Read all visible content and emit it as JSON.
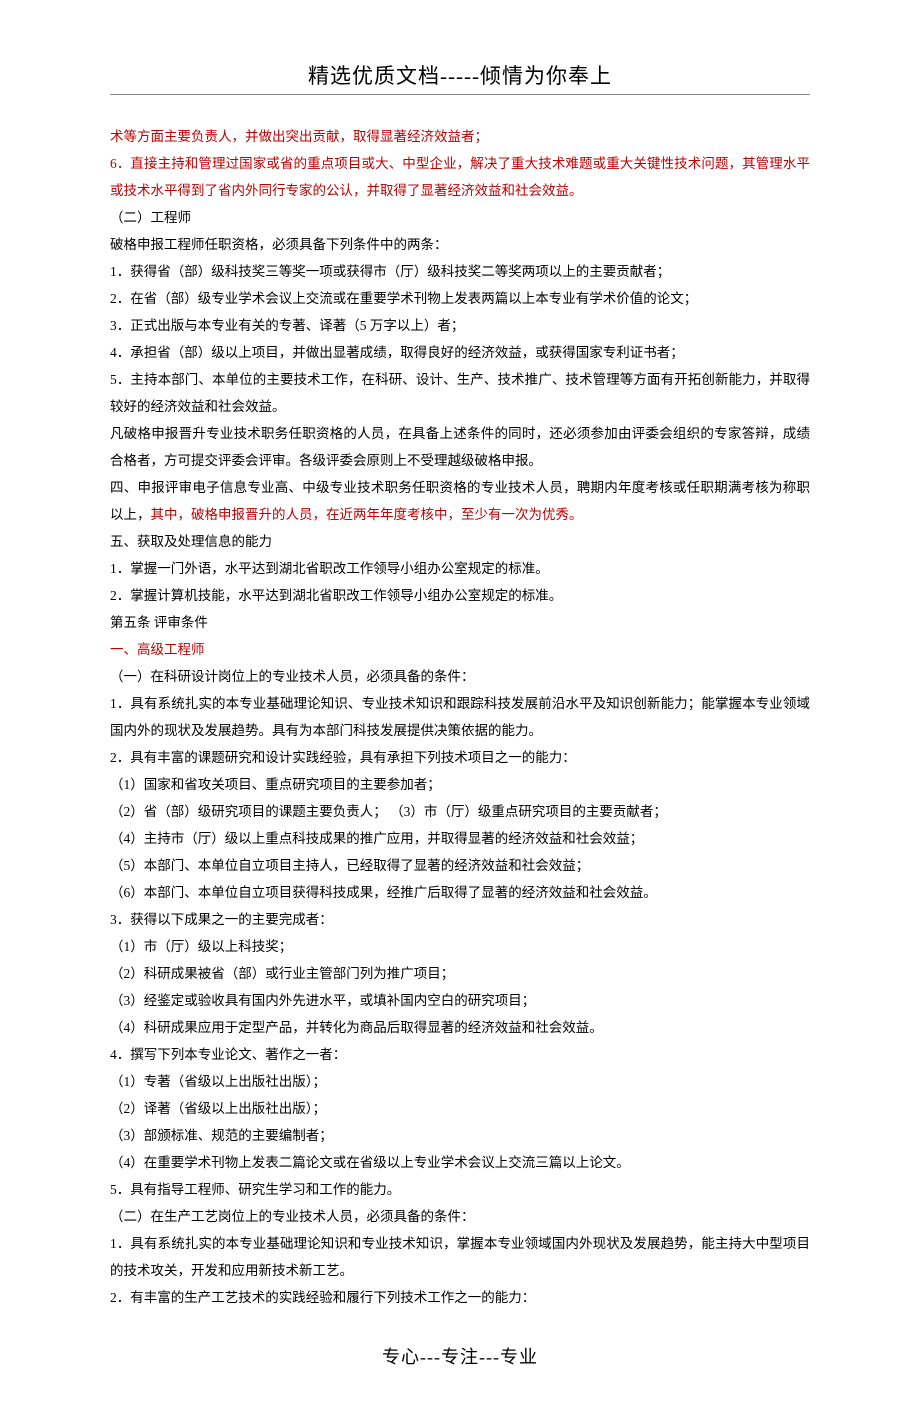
{
  "header": "精选优质文档-----倾情为你奉上",
  "footer": "专心---专注---专业",
  "lines": [
    {
      "text": "术等方面主要负责人，并做出突出贡献，取得显著经济效益者；",
      "red": true
    },
    {
      "text": "6．直接主持和管理过国家或省的重点项目或大、中型企业，解决了重大技术难题或重大关键性技术问题，其管理水平或技术水平得到了省内外同行专家的公认，并取得了显著经济效益和社会效益。",
      "red": true
    },
    {
      "text": "（二）工程师",
      "red": false
    },
    {
      "text": "破格申报工程师任职资格，必须具备下列条件中的两条：",
      "red": false
    },
    {
      "text": "1．获得省（部）级科技奖三等奖一项或获得市（厅）级科技奖二等奖两项以上的主要贡献者；",
      "red": false
    },
    {
      "text": "2．在省（部）级专业学术会议上交流或在重要学术刊物上发表两篇以上本专业有学术价值的论文；",
      "red": false
    },
    {
      "text": "3．正式出版与本专业有关的专著、译著（5 万字以上）者；",
      "red": false
    },
    {
      "text": "4．承担省（部）级以上项目，并做出显著成绩，取得良好的经济效益，或获得国家专利证书者；",
      "red": false
    },
    {
      "text": "5．主持本部门、本单位的主要技术工作，在科研、设计、生产、技术推广、技术管理等方面有开拓创新能力，并取得较好的经济效益和社会效益。",
      "red": false
    },
    {
      "text": "凡破格申报晋升专业技术职务任职资格的人员，在具备上述条件的同时，还必须参加由评委会组织的专家答辩，成绩合格者，方可提交评委会评审。各级评委会原则上不受理越级破格申报。",
      "red": false
    },
    {
      "text": "四、申报评审电子信息专业高、中级专业技术职务任职资格的专业技术人员，聘期内年度考核或任职期满考核为称职以上，",
      "red": false,
      "trailing_red": "其中，破格申报晋升的人员，在近两年年度考核中，至少有一次为优秀。"
    },
    {
      "text": "五、获取及处理信息的能力",
      "red": false
    },
    {
      "text": "1．掌握一门外语，水平达到湖北省职改工作领导小组办公室规定的标准。",
      "red": false
    },
    {
      "text": "2．掌握计算机技能，水平达到湖北省职改工作领导小组办公室规定的标准。",
      "red": false
    },
    {
      "text": "第五条  评审条件",
      "red": false
    },
    {
      "text": "一、高级工程师",
      "red": true
    },
    {
      "text": "（一）在科研设计岗位上的专业技术人员，必须具备的条件：",
      "red": false
    },
    {
      "text": "1．具有系统扎实的本专业基础理论知识、专业技术知识和跟踪科技发展前沿水平及知识创新能力；能掌握本专业领域国内外的现状及发展趋势。具有为本部门科技发展提供决策依据的能力。",
      "red": false
    },
    {
      "text": "2．具有丰富的课题研究和设计实践经验，具有承担下列技术项目之一的能力：",
      "red": false
    },
    {
      "text": "（1）国家和省攻关项目、重点研究项目的主要参加者；",
      "red": false
    },
    {
      "text": "（2）省（部）级研究项目的课题主要负责人； （3）市（厅）级重点研究项目的主要贡献者；",
      "red": false
    },
    {
      "text": "（4）主持市（厅）级以上重点科技成果的推广应用，并取得显著的经济效益和社会效益；",
      "red": false
    },
    {
      "text": "（5）本部门、本单位自立项目主持人，已经取得了显著的经济效益和社会效益；",
      "red": false
    },
    {
      "text": "（6）本部门、本单位自立项目获得科技成果，经推广后取得了显著的经济效益和社会效益。",
      "red": false
    },
    {
      "text": "3．获得以下成果之一的主要完成者：",
      "red": false
    },
    {
      "text": "（1）市（厅）级以上科技奖；",
      "red": false
    },
    {
      "text": "（2）科研成果被省（部）或行业主管部门列为推广项目；",
      "red": false
    },
    {
      "text": "（3）经鉴定或验收具有国内外先进水平，或填补国内空白的研究项目；",
      "red": false
    },
    {
      "text": "（4）科研成果应用于定型产品，并转化为商品后取得显著的经济效益和社会效益。",
      "red": false
    },
    {
      "text": "4．撰写下列本专业论文、著作之一者：",
      "red": false
    },
    {
      "text": "（1）专著（省级以上出版社出版）；",
      "red": false
    },
    {
      "text": "（2）译著（省级以上出版社出版）；",
      "red": false
    },
    {
      "text": "（3）部颁标准、规范的主要编制者；",
      "red": false
    },
    {
      "text": "（4）在重要学术刊物上发表二篇论文或在省级以上专业学术会议上交流三篇以上论文。",
      "red": false
    },
    {
      "text": "5．具有指导工程师、研究生学习和工作的能力。",
      "red": false
    },
    {
      "text": "（二）在生产工艺岗位上的专业技术人员，必须具备的条件：",
      "red": false
    },
    {
      "text": "1．具有系统扎实的本专业基础理论知识和专业技术知识，掌握本专业领域国内外现状及发展趋势，能主持大中型项目的技术攻关，开发和应用新技术新工艺。",
      "red": false
    },
    {
      "text": "2．有丰富的生产工艺技术的实践经验和履行下列技术工作之一的能力：",
      "red": false
    }
  ]
}
